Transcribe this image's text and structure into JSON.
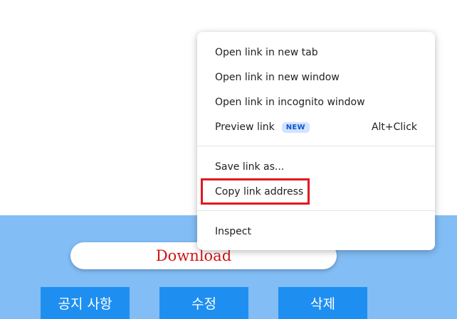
{
  "page": {
    "download_label": "Download",
    "buttons": [
      "공지 사항",
      "수정",
      "삭제"
    ]
  },
  "context_menu": {
    "items": [
      {
        "label": "Open link in new tab"
      },
      {
        "label": "Open link in new window"
      },
      {
        "label": "Open link in incognito window"
      },
      {
        "label": "Preview link",
        "badge": "NEW",
        "shortcut": "Alt+Click"
      },
      {
        "label": "Save link as..."
      },
      {
        "label": "Copy link address",
        "highlighted": true
      },
      {
        "label": "Inspect"
      }
    ]
  },
  "colors": {
    "panel_blue": "#82bdf5",
    "button_blue": "#1e8ff0",
    "download_red": "#d21414",
    "highlight_red": "#e0191f",
    "badge_bg": "#d3e3fd",
    "badge_text": "#0b57d0"
  }
}
